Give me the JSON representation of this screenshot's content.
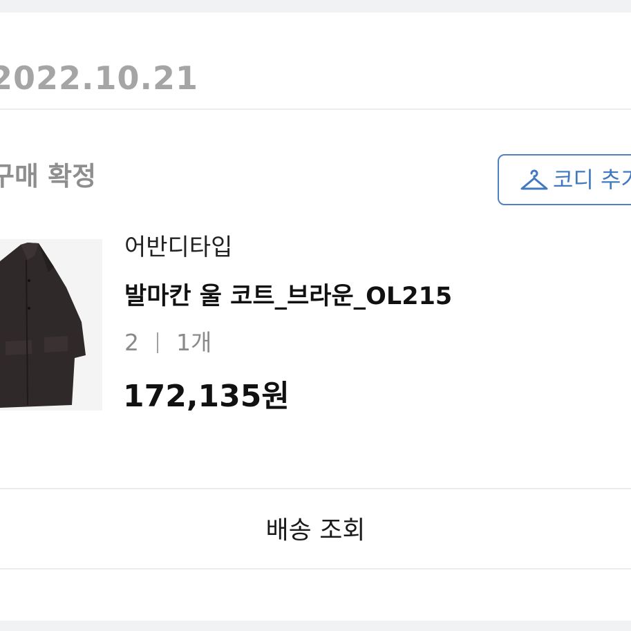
{
  "order": {
    "date": "2022.10.21",
    "status": "구매 확정",
    "coordi_button_label": "코디 추가"
  },
  "product": {
    "image": "brown-coat-photo",
    "brand": "어반디타입",
    "name": "발마칸 울 코트_브라운_OL215",
    "option_size": "2",
    "option_qty": "1개",
    "price": "172,135원"
  },
  "actions": {
    "track_delivery_label": "배송 조회"
  },
  "colors": {
    "accent": "#4e80c4",
    "muted_text": "#a5a5a5"
  },
  "icons": [
    "hanger-icon"
  ]
}
